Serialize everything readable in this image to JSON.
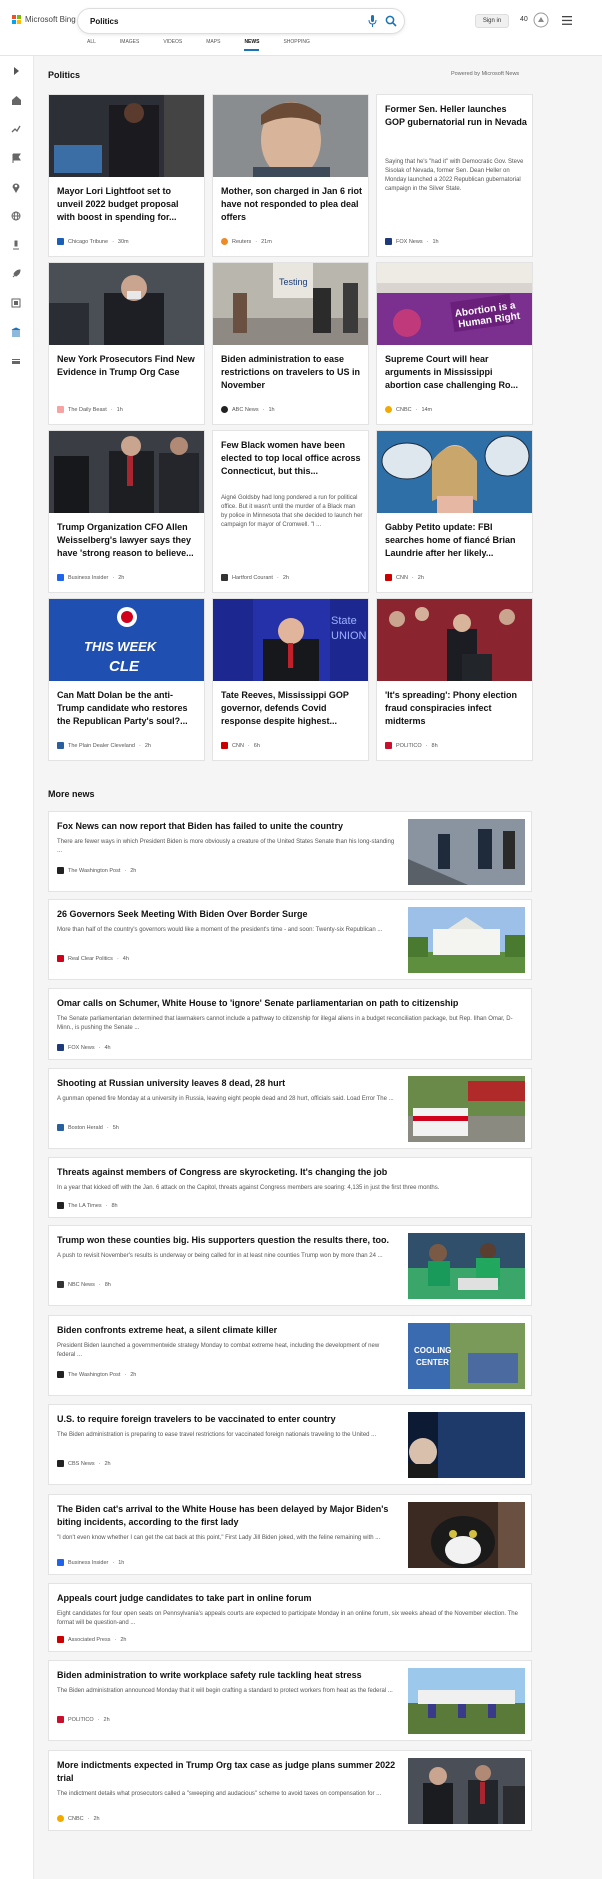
{
  "header": {
    "logo_text": "Microsoft Bing",
    "query": "Politics",
    "signin": "Sign in",
    "points": "40"
  },
  "tabs": [
    "ALL",
    "IMAGES",
    "VIDEOS",
    "MAPS",
    "NEWS",
    "SHOPPING"
  ],
  "main": {
    "title": "Politics",
    "powered_by": "Powered by Microsoft News"
  },
  "cards": [
    {
      "title": "Mayor Lori Lightfoot set to unveil 2022 budget proposal with boost in spending for...",
      "source": "Chicago Tribune",
      "time": "30m",
      "color": "#1a5fb4"
    },
    {
      "title": "Mother, son charged in Jan 6 riot have not responded to plea deal offers",
      "source": "Reuters",
      "time": "21m",
      "color": "#f08a24"
    },
    {
      "title": "Former Sen. Heller launches GOP gubernatorial run in Nevada",
      "snippet": "Saying that he's \"had it\" with Democratic Gov. Steve Sisolak of Nevada, former Sen. Dean Heller on Monday launched a 2022 Republican gubernatorial campaign in the Silver State.",
      "source": "FOX News",
      "time": "1h",
      "color": "#1f3a7a"
    },
    {
      "title": "New York Prosecutors Find New Evidence in Trump Org Case",
      "source": "The Daily Beast",
      "time": "1h",
      "color": "#f5a3a3"
    },
    {
      "title": "Biden administration to ease restrictions on travelers to US in November",
      "source": "ABC News",
      "time": "1h",
      "color": "#222"
    },
    {
      "title": "Supreme Court will hear arguments in Mississippi abortion case challenging Ro...",
      "source": "CNBC",
      "time": "14m",
      "color": "#f2a900"
    },
    {
      "title": "Trump Organization CFO Allen Weisselberg's lawyer says they have 'strong reason to believe...",
      "source": "Business Insider",
      "time": "2h",
      "color": "#1e63e9"
    },
    {
      "title": "Few Black women have been elected to top local office across Connecticut, but this...",
      "snippet": "Aigné Goldsby had long pondered a run for political office. But it wasn't until the murder of a Black man by police in Minnesota that she decided to launch her campaign for mayor of Cromwell. \"I ...",
      "source": "Hartford Courant",
      "time": "2h",
      "color": "#333"
    },
    {
      "title": "Gabby Petito update: FBI searches home of fiancé Brian Laundrie after her likely...",
      "source": "CNN",
      "time": "2h",
      "color": "#cc0000"
    },
    {
      "title": "Can Matt Dolan be the anti-Trump candidate who restores the Republican Party's soul?...",
      "source": "The Plain Dealer Cleveland",
      "time": "2h",
      "color": "#2a5f9e"
    },
    {
      "title": "Tate Reeves, Mississippi GOP governor, defends Covid response despite highest...",
      "source": "CNN",
      "time": "6h",
      "color": "#cc0000"
    },
    {
      "title": "'It's spreading': Phony election fraud conspiracies infect midterms",
      "source": "POLITICO",
      "time": "8h",
      "color": "#c8102e"
    }
  ],
  "more_title": "More news",
  "news": [
    {
      "title": "Fox News can now report that Biden has failed to unite the country",
      "snippet": "There are fewer ways in which President Biden is more obviously a creature of the United States Senate than his long-standing ...",
      "source": "The Washington Post",
      "time": "2h",
      "color": "#222"
    },
    {
      "title": "26 Governors Seek Meeting With Biden Over Border Surge",
      "snippet": "More than half of the country's governors would like a moment of the president's time - and soon: Twenty-six Republican ...",
      "source": "Real Clear Politics",
      "time": "4h",
      "color": "#d0021b"
    },
    {
      "title": "Omar calls on Schumer, White House to 'ignore' Senate parliamentarian on path to citizenship",
      "snippet": "The Senate parliamentarian determined that lawmakers cannot include a pathway to citizenship for illegal aliens in a budget reconciliation package, but Rep. Ilhan Omar, D-Minn., is pushing the Senate ...",
      "source": "FOX News",
      "time": "4h",
      "color": "#1f3a7a"
    },
    {
      "title": "Shooting at Russian university leaves 8 dead, 28 hurt",
      "snippet": "A gunman opened fire Monday at a university in Russia, leaving eight people dead and 28 hurt, officials said. Load Error The ...",
      "source": "Boston Herald",
      "time": "5h",
      "color": "#2a5f9e"
    },
    {
      "title": "Threats against members of Congress are skyrocketing. It's changing the job",
      "snippet": "In a year that kicked off with the Jan. 6 attack on the Capitol, threats against Congress members are soaring: 4,135 in just the first three months.",
      "source": "The LA Times",
      "time": "8h",
      "color": "#222"
    },
    {
      "title": "Trump won these counties big. His supporters question the results there, too.",
      "snippet": "A push to revisit November's results is underway or being called for in at least nine counties Trump won by more than 24 ...",
      "source": "NBC News",
      "time": "8h",
      "color": "#333"
    },
    {
      "title": "Biden confronts extreme heat, a silent climate killer",
      "snippet": "President Biden launched a governmentwide strategy Monday to combat extreme heat, including the development of new federal ...",
      "source": "The Washington Post",
      "time": "2h",
      "color": "#222"
    },
    {
      "title": "U.S. to require foreign travelers to be vaccinated to enter country",
      "snippet": "The Biden administration is preparing to ease travel restrictions for vaccinated foreign nationals traveling to the United ...",
      "source": "CBS News",
      "time": "2h",
      "color": "#222"
    },
    {
      "title": "The Biden cat's arrival to the White House has been delayed by Major Biden's biting incidents, according to the first lady",
      "snippet": "\"I don't even know whether I can get the cat back at this point,\" First Lady Jill Biden joked, with the feline remaining with ...",
      "source": "Business Insider",
      "time": "1h",
      "color": "#1e63e9"
    },
    {
      "title": "Appeals court judge candidates to take part in online forum",
      "snippet": "Eight candidates for four open seats on Pennsylvania's appeals courts are expected to participate Monday in an online forum, six weeks ahead of the November election. The format will be question-and ...",
      "source": "Associated Press",
      "time": "2h",
      "color": "#c00"
    },
    {
      "title": "Biden administration to write workplace safety rule tackling heat stress",
      "snippet": "The Biden administration announced Monday that it will begin crafting a standard to protect workers from heat as the federal ...",
      "source": "POLITICO",
      "time": "2h",
      "color": "#c8102e"
    },
    {
      "title": "More indictments expected in Trump Org tax case as judge plans summer 2022 trial",
      "snippet": "The indictment details what prosecutors called a \"sweeping and audacious\" scheme to avoid taxes on compensation for ...",
      "source": "CNBC",
      "time": "2h",
      "color": "#f2a900"
    }
  ]
}
